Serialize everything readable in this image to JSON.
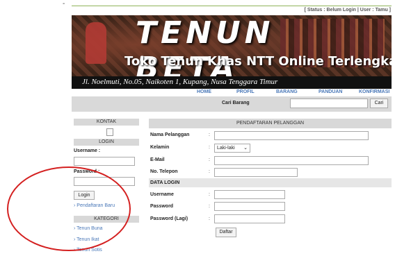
{
  "header": {
    "status_text": "[ Status : Belum Login | User : Tamu ]",
    "title": "TENUN BETA",
    "subtitle": "Toko Tenun Khas NTT Online Terlengkap",
    "address": "Jl. Noelmuti, No.05, Naikoten 1, Kupang, Nusa Tenggara Timur"
  },
  "nav": {
    "items": [
      "HOME",
      "PROFIL",
      "BARANG",
      "PANDUAN",
      "KONFIRMASI"
    ]
  },
  "search": {
    "label": "Cari Barang",
    "value": "",
    "button": "Cari"
  },
  "sidebar": {
    "contact_heading": "KONTAK",
    "login_heading": "LOGIN",
    "username_label": "Username :",
    "password_label": "Password :",
    "login_button": "Login",
    "register_link": "› Pendaftaran Baru",
    "category_heading": "KATEGORI",
    "categories": [
      "› Tenun Buna",
      "› Tenun Ikat",
      "› Tenun Sotis"
    ]
  },
  "form": {
    "heading": "PENDAFTARAN PELANGGAN",
    "name_label": "Nama Pelanggan",
    "gender_label": "Kelamin",
    "gender_value": "Laki-laki",
    "email_label": "E-Mail",
    "phone_label": "No. Telepon",
    "login_section": "DATA LOGIN",
    "username_label": "Username",
    "password_label": "Password",
    "password_again_label": "Password (Lagi)",
    "colon": ":",
    "submit_label": "Daftar"
  },
  "colors": {
    "nav_link": "#4a78b8",
    "annotation_circle": "#d42020"
  }
}
